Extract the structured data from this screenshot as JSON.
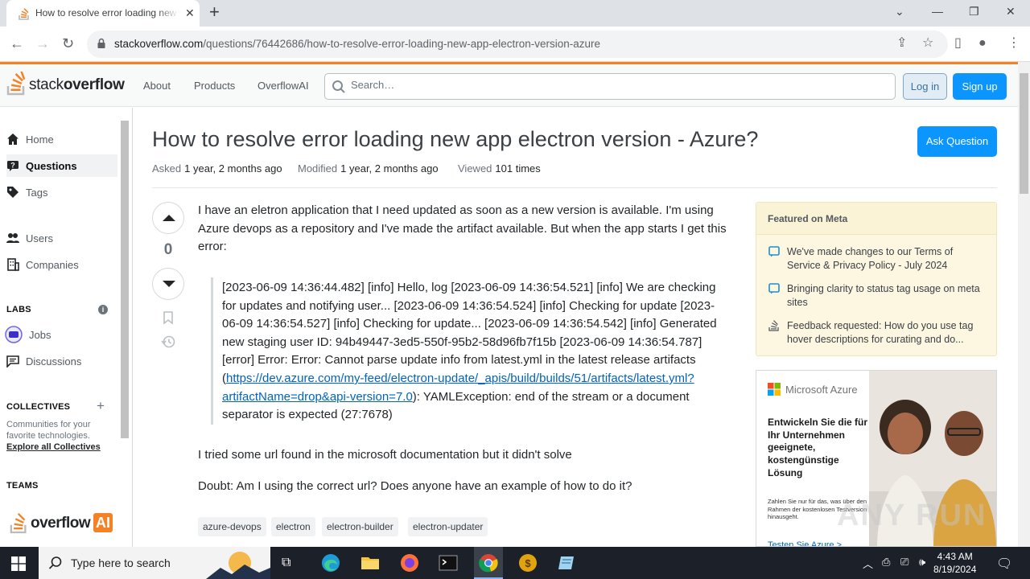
{
  "browser": {
    "tab_title": "How to resolve error loading new app electron version - Azure? - Stack Overflow",
    "new_tab": "+",
    "url_domain": "stackoverflow.com",
    "url_path": "/questions/76442686/how-to-resolve-error-loading-new-app-electron-version-azure"
  },
  "so_header": {
    "logo_light": "stack",
    "logo_bold": "overflow",
    "nav": [
      "About",
      "Products",
      "OverflowAI"
    ],
    "search_placeholder": "Search…",
    "login": "Log in",
    "signup": "Sign up"
  },
  "sidebar": {
    "items": [
      {
        "label": "Home"
      },
      {
        "label": "Questions"
      },
      {
        "label": "Tags"
      },
      {
        "label": "Users"
      },
      {
        "label": "Companies"
      }
    ],
    "labs_heading": "LABS",
    "labs_items": [
      {
        "label": "Jobs"
      },
      {
        "label": "Discussions"
      }
    ],
    "collectives_heading": "COLLECTIVES",
    "collectives_text": "Communities for your favorite technologies.",
    "collectives_link": "Explore all Collectives",
    "teams_heading": "TEAMS",
    "overflow_ai_text": "overflow",
    "overflow_ai_badge": "AI"
  },
  "question": {
    "title": "How to resolve error loading new app electron version - Azure?",
    "ask_button": "Ask Question",
    "asked_label": "Asked",
    "asked_value": "1 year, 2 months ago",
    "modified_label": "Modified",
    "modified_value": "1 year, 2 months ago",
    "viewed_label": "Viewed",
    "viewed_value": "101 times",
    "votes": "0",
    "intro": "I have an eletron application that I need updated as soon as a new version is available. I'm using Azure devops as a repository and I've made the artifact available. But when the app starts I get this error:",
    "log_text": "[2023-06-09 14:36:44.482] [info] Hello, log [2023-06-09 14:36:54.521] [info] We are checking for updates and notifying user... [2023-06-09 14:36:54.524] [info] Checking for update [2023-06-09 14:36:54.527] [info] Checking for update... [2023-06-09 14:36:54.542] [info] Generated new staging user ID: 94b49447-3ed5-550f-95b2-58d96fb7f15b [2023-06-09 14:36:54.787] [error] Error: Error: Cannot parse update info from latest.yml in the latest release artifacts (",
    "log_link": "https://dev.azure.com/my-feed/electron-update/_apis/build/builds/51/artifacts/latest.yml?artifactName=drop&api-version=7.0",
    "log_tail": "): YAMLException: end of the stream or a document separator is expected (27:7678)",
    "para2": "I tried some url found in the microsoft documentation but it didn't solve",
    "para3": "Doubt: Am I using the correct url? Does anyone have an example of how to do it?",
    "tags": [
      "azure-devops",
      "electron",
      "electron-builder",
      "electron-updater"
    ]
  },
  "featured_meta": {
    "heading": "Featured on Meta",
    "items": [
      "We've made changes to our Terms of Service & Privacy Policy - July 2024",
      "Bringing clarity to status tag usage on meta sites",
      "Feedback requested: How do you use tag hover descriptions for curating and do..."
    ]
  },
  "ad": {
    "brand": "Microsoft Azure",
    "headline": "Entwickeln Sie die für Ihr Unternehmen geeignete, kostengünstige Lösung",
    "fine_print": "Zahlen Sie nur für das, was über den Rahmen der kostenlosen Testversion hinausgeht.",
    "cta": "Testen Sie Azure >"
  },
  "taskbar": {
    "search_text": "Type here to search",
    "time": "4:43 AM",
    "date": "8/19/2024"
  },
  "watermark": "ANY RUN",
  "colors": {
    "so_orange": "#f48225",
    "so_blue": "#0a95ff",
    "link": "#0063bf",
    "meta_bg": "#fdf7e2"
  }
}
